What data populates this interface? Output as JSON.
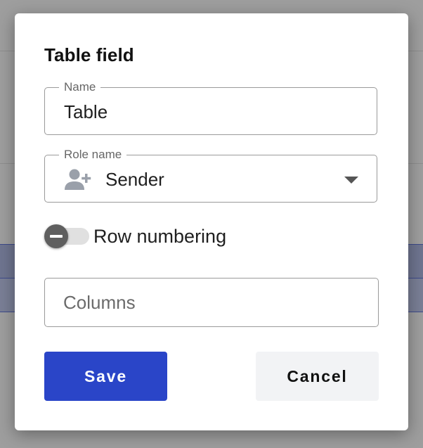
{
  "dialog": {
    "title": "Table field",
    "name_field": {
      "label": "Name",
      "value": "Table"
    },
    "role_field": {
      "label": "Role name",
      "value": "Sender",
      "icon": "person-add-icon",
      "dropdown_icon": "arrow-drop-down-icon"
    },
    "row_numbering": {
      "label": "Row numbering",
      "state": "off"
    },
    "columns_field": {
      "placeholder": "Columns",
      "value": ""
    },
    "buttons": {
      "save_label": "Save",
      "cancel_label": "Cancel"
    }
  },
  "colors": {
    "primary": "#2a45c8",
    "cancel_background": "#f2f3f5",
    "field_border": "#9a9a9a",
    "backdrop": "#9e9e9e"
  }
}
